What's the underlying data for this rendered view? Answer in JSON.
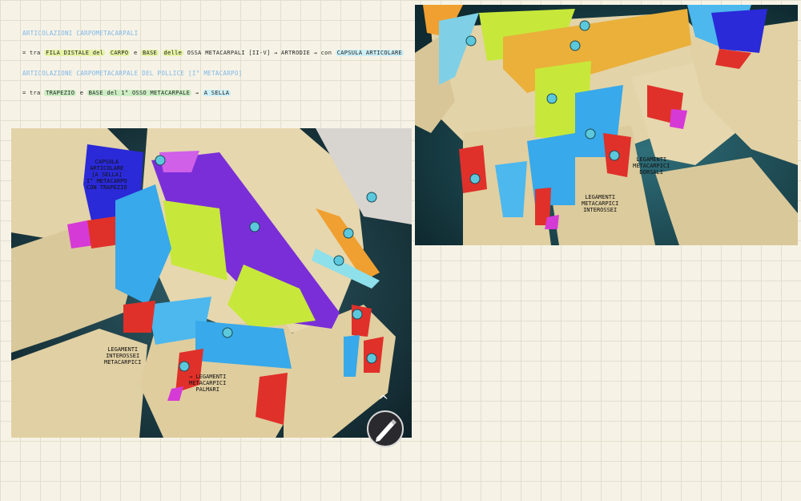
{
  "notes": {
    "title1": "ARTICOLAZIONI CARPOMETACARPALI",
    "line1": {
      "prefix": "= tra",
      "hl1": "FILA DISTALE del",
      "hl2": "CARPO",
      "mid": "e",
      "hl3": "BASE",
      "hl4": "delle",
      "rest": "OSSA METACARPALI [II-V] → ARTRODIE → con",
      "hl5": "CAPSULA ARTICOLARE"
    },
    "title2": "ARTICOLAZIONE CARPOMETACARPALE DEL POLLICE [I° METACARPO]",
    "line2": {
      "prefix": "= tra",
      "hl1": "TRAPEZIO",
      "mid": "e",
      "hl2": "BASE del 1° OSSO METACARPALE",
      "rest": "→",
      "hl3": "A SELLA"
    }
  },
  "left_image": {
    "labels": {
      "capsula": [
        "CAPSULA",
        "ARTICOLARE",
        "[A SELLA]",
        "I° METACARPO",
        "CON TRAPEZIO"
      ],
      "interossei": [
        "LEGAMENTI",
        "INTEROSSEI",
        "METACARPICI"
      ],
      "palmari": [
        "→ LEGAMENTI",
        "METACARPICI",
        "PALMARI"
      ]
    },
    "colors": {
      "bone": "#e3d3a8",
      "purple": "#7a2ed8",
      "blue": "#38a9ea",
      "green": "#c7e83a",
      "red": "#e0302a",
      "navy": "#2a2ad8",
      "orange": "#f0a030"
    }
  },
  "right_image": {
    "labels": {
      "dorsali": [
        "LEGAMENTI",
        "METACARPICI",
        "DORSALI"
      ],
      "interossei": [
        "LEGAMENTI",
        "METACARPICI",
        "INTEROSSEI"
      ]
    }
  },
  "toolbar": {
    "pencil_icon": "pencil-icon",
    "chevron_icon": "chevron-up-icon"
  }
}
